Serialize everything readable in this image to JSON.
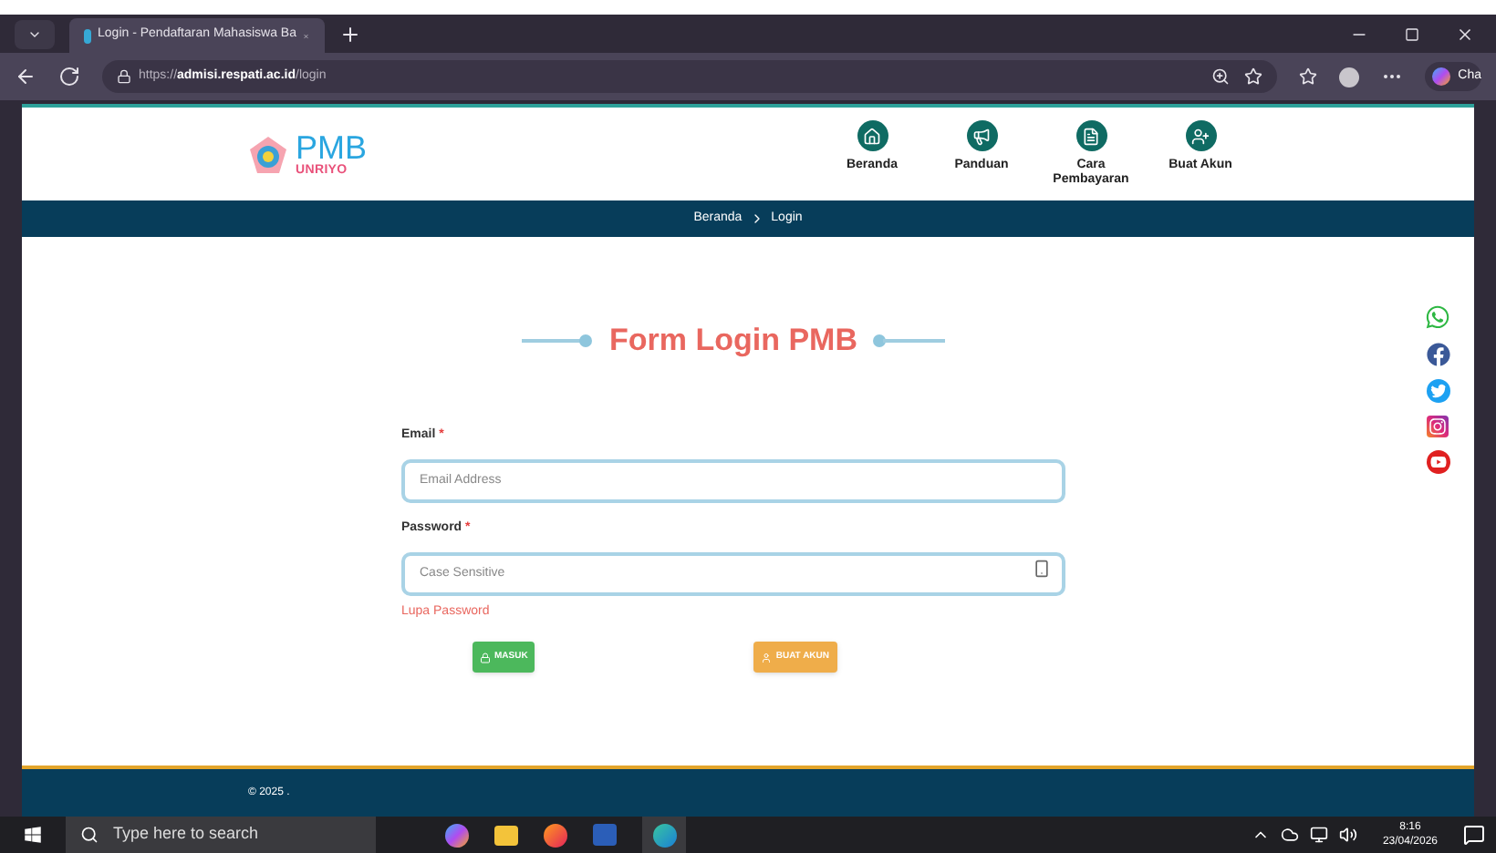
{
  "browser": {
    "tab_title": "Login - Pendaftaran Mahasiswa Ba",
    "url_prefix": "https://",
    "url_host": "admisi.respati.ac.id",
    "url_path": "/login",
    "copilot_label": "Cha"
  },
  "header": {
    "logo_title": "PMB",
    "logo_subtitle": "UNRIYO",
    "nav": [
      {
        "label": "Beranda"
      },
      {
        "label": "Panduan"
      },
      {
        "label": "Cara Pembayaran"
      },
      {
        "label": "Buat Akun"
      }
    ]
  },
  "breadcrumb": [
    "Beranda",
    "Login"
  ],
  "form": {
    "title": "Form Login PMB",
    "fields": [
      {
        "label": "Email",
        "mark": "*",
        "placeholder": "Email Address",
        "kind": "text"
      },
      {
        "label": "Password",
        "mark": "*",
        "placeholder": "Case Sensitive",
        "kind": "password"
      }
    ],
    "forgot_link": "Lupa Password",
    "buttons": [
      {
        "label": "MASUK",
        "kind": "login"
      },
      {
        "label": "BUAT AKUN",
        "kind": "register"
      }
    ]
  },
  "footer": {
    "copyright": "© 2025 ."
  },
  "taskbar": {
    "search_placeholder": "Type here to search",
    "time": "8:16",
    "date": "23/04/2026"
  }
}
